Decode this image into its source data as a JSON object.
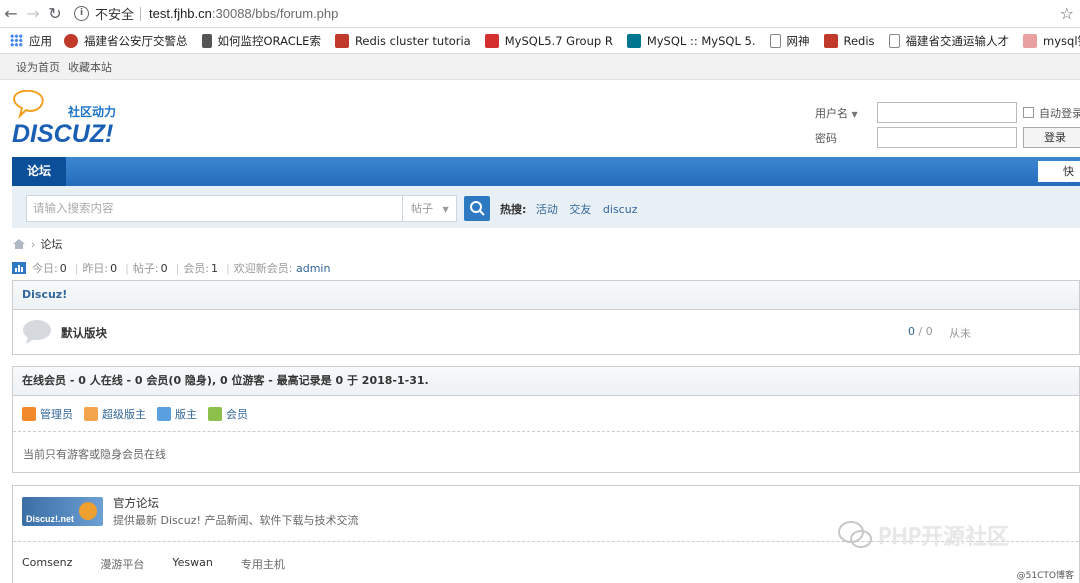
{
  "browser": {
    "insecure_label": "不安全",
    "url_host": "test.fjhb.cn",
    "url_path": ":30088/bbs/forum.php",
    "bookmarks": [
      {
        "label": "应用",
        "color": "#4285f4"
      },
      {
        "label": "福建省公安厅交警总",
        "color": "#c0392b"
      },
      {
        "label": "如何监控ORACLE索",
        "color": "#444444"
      },
      {
        "label": "Redis cluster tutoria",
        "color": "#c0392b"
      },
      {
        "label": "MySQL5.7 Group R",
        "color": "#d32f2f"
      },
      {
        "label": "MySQL :: MySQL 5.",
        "color": "#00758f"
      },
      {
        "label": "网神",
        "color": "#888888"
      },
      {
        "label": "Redis",
        "color": "#c0392b"
      },
      {
        "label": "福建省交通运输人才",
        "color": "#888888"
      },
      {
        "label": "mysql锁",
        "color": "#e8a0a0"
      }
    ]
  },
  "topbar": {
    "set_home": "设为首页",
    "bookmark": "收藏本站"
  },
  "logo": {
    "tagline": "社区动力",
    "name": "DISCUZ!"
  },
  "login": {
    "username_label": "用户名",
    "password_label": "密码",
    "auto_login": "自动登录",
    "login_button": "登录"
  },
  "nav": {
    "forum_tab": "论坛",
    "quick": "快捷"
  },
  "search": {
    "placeholder": "请输入搜索内容",
    "type": "帖子",
    "hot_label": "热搜:",
    "hot_terms": [
      "活动",
      "交友",
      "discuz"
    ]
  },
  "breadcrumb": {
    "current": "论坛"
  },
  "stats": {
    "today_label": "今日:",
    "today": "0",
    "yesterday_label": "昨日:",
    "yesterday": "0",
    "posts_label": "帖子:",
    "posts": "0",
    "members_label": "会员:",
    "members": "1",
    "welcome_label": "欢迎新会员:",
    "newest": "admin"
  },
  "category": {
    "title": "Discuz!",
    "forum_name": "默认版块",
    "threads": "0",
    "posts": "0",
    "last": "从未"
  },
  "online": {
    "header": "在线会员 - 0 人在线 - 0 会员(0 隐身), 0 位游客 - 最高记录是 0 于 2018-1-31.",
    "legend": [
      {
        "label": "管理员",
        "color": "#f28a2c"
      },
      {
        "label": "超级版主",
        "color": "#f2a54c"
      },
      {
        "label": "版主",
        "color": "#5aa0e0"
      },
      {
        "label": "会员",
        "color": "#8cc04a"
      }
    ],
    "message": "当前只有游客或隐身会员在线"
  },
  "links": {
    "badge": "Discuz!.net",
    "title": "官方论坛",
    "desc": "提供最新 Discuz! 产品新闻、软件下载与技术交流",
    "friends": [
      "Comsenz",
      "漫游平台",
      "Yeswan",
      "专用主机"
    ]
  },
  "watermark": {
    "text": "PHP开源社区",
    "copyright": "@51CTO博客"
  }
}
